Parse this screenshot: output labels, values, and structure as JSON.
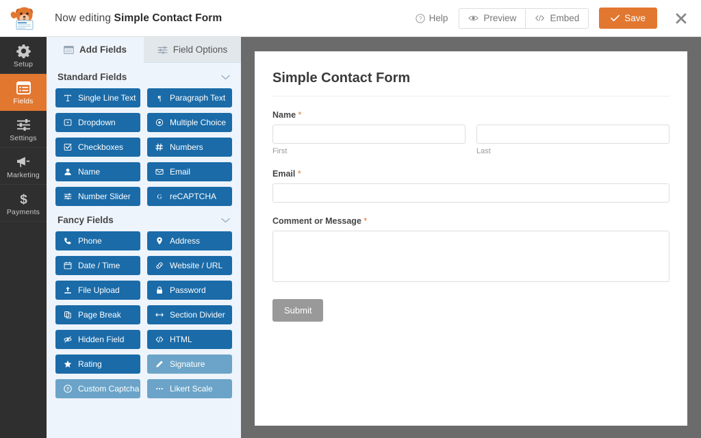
{
  "header": {
    "editing_prefix": "Now editing",
    "form_name": "Simple Contact Form",
    "help_label": "Help",
    "preview_label": "Preview",
    "embed_label": "Embed",
    "save_label": "Save",
    "close_label": "Close",
    "logo_name": "wpforms-mascot-logo",
    "accent_color": "#e27730"
  },
  "sidebar": {
    "items": [
      {
        "label": "Setup",
        "icon": "gear-icon",
        "active": false
      },
      {
        "label": "Fields",
        "icon": "list-icon",
        "active": true
      },
      {
        "label": "Settings",
        "icon": "sliders-icon",
        "active": false
      },
      {
        "label": "Marketing",
        "icon": "megaphone-icon",
        "active": false
      },
      {
        "label": "Payments",
        "icon": "dollar-icon",
        "active": false
      }
    ]
  },
  "panel": {
    "tabs": [
      {
        "label": "Add Fields",
        "icon": "add-fields-icon",
        "active": true
      },
      {
        "label": "Field Options",
        "icon": "field-options-icon",
        "active": false
      }
    ],
    "sections": [
      {
        "title": "Standard Fields",
        "collapsed": false,
        "fields": [
          {
            "label": "Single Line Text",
            "icon": "text-icon",
            "dim": false
          },
          {
            "label": "Paragraph Text",
            "icon": "paragraph-icon",
            "dim": false
          },
          {
            "label": "Dropdown",
            "icon": "dropdown-icon",
            "dim": false
          },
          {
            "label": "Multiple Choice",
            "icon": "radio-icon",
            "dim": false
          },
          {
            "label": "Checkboxes",
            "icon": "checkbox-icon",
            "dim": false
          },
          {
            "label": "Numbers",
            "icon": "hash-icon",
            "dim": false
          },
          {
            "label": "Name",
            "icon": "user-icon",
            "dim": false
          },
          {
            "label": "Email",
            "icon": "envelope-icon",
            "dim": false
          },
          {
            "label": "Number Slider",
            "icon": "slider-icon",
            "dim": false
          },
          {
            "label": "reCAPTCHA",
            "icon": "google-g-icon",
            "dim": false
          }
        ]
      },
      {
        "title": "Fancy Fields",
        "collapsed": false,
        "fields": [
          {
            "label": "Phone",
            "icon": "phone-icon",
            "dim": false
          },
          {
            "label": "Address",
            "icon": "map-pin-icon",
            "dim": false
          },
          {
            "label": "Date / Time",
            "icon": "calendar-icon",
            "dim": false
          },
          {
            "label": "Website / URL",
            "icon": "link-icon",
            "dim": false
          },
          {
            "label": "File Upload",
            "icon": "upload-icon",
            "dim": false
          },
          {
            "label": "Password",
            "icon": "lock-icon",
            "dim": false
          },
          {
            "label": "Page Break",
            "icon": "page-break-icon",
            "dim": false
          },
          {
            "label": "Section Divider",
            "icon": "arrows-h-icon",
            "dim": false
          },
          {
            "label": "Hidden Field",
            "icon": "eye-slash-icon",
            "dim": false
          },
          {
            "label": "HTML",
            "icon": "code-icon",
            "dim": false
          },
          {
            "label": "Rating",
            "icon": "star-icon",
            "dim": false
          },
          {
            "label": "Signature",
            "icon": "pencil-icon",
            "dim": true
          },
          {
            "label": "Custom Captcha",
            "icon": "question-icon",
            "dim": true
          },
          {
            "label": "Likert Scale",
            "icon": "ellipsis-icon",
            "dim": true
          }
        ]
      }
    ]
  },
  "preview": {
    "form_title": "Simple Contact Form",
    "required_marker": "*",
    "fields": [
      {
        "label": "Name",
        "required": true,
        "type": "name",
        "subfields": [
          {
            "sublabel": "First",
            "value": ""
          },
          {
            "sublabel": "Last",
            "value": ""
          }
        ]
      },
      {
        "label": "Email",
        "required": true,
        "type": "text",
        "value": ""
      },
      {
        "label": "Comment or Message",
        "required": true,
        "type": "textarea",
        "value": ""
      }
    ],
    "submit_label": "Submit"
  }
}
